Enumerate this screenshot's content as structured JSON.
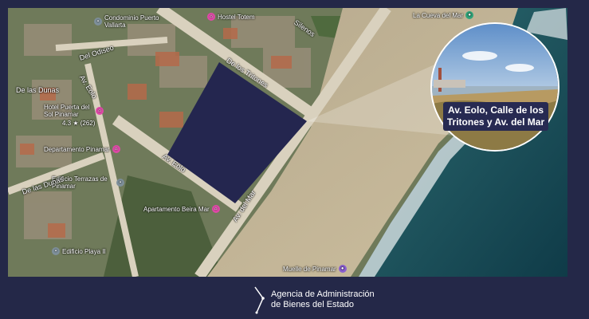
{
  "map": {
    "pois": [
      {
        "label": "Hostel Totem",
        "color": "pink"
      },
      {
        "label": "Condominio Puerto Vallarta",
        "color": "gray"
      },
      {
        "label": "Hotel Puerta del Sol Pinamar",
        "color": "pink"
      },
      {
        "label": "Departamento Pinamar",
        "color": "pink"
      },
      {
        "label": "Edificio Terrazas de Pinamar",
        "color": "gray"
      },
      {
        "label": "Apartamento Beira Mar",
        "color": "pink"
      },
      {
        "label": "Edificio Playa II",
        "color": "gray"
      },
      {
        "label": "Muelle de Pinamar",
        "color": "purple"
      },
      {
        "label": "La Cueva del Mar",
        "color": "green"
      }
    ],
    "streets": [
      "Del Odiseo",
      "Av. Eolo",
      "De los Tritones",
      "Av. del Mar",
      "De las Dunas",
      "Silenos",
      "Av. Eolo",
      "De las Dunas"
    ],
    "rating": "4.3 ★ (262)",
    "highlighted_plot": "selected-lot"
  },
  "callout": {
    "label": "Av. Eolo, Calle de los Tritones y Av. del Mar"
  },
  "footer": {
    "agency_line1": "Agencia de Administración",
    "agency_line2": "de Bienes del Estado"
  },
  "colors": {
    "background": "#242848",
    "plot": "#24264f",
    "label_bg": "#272a52"
  }
}
